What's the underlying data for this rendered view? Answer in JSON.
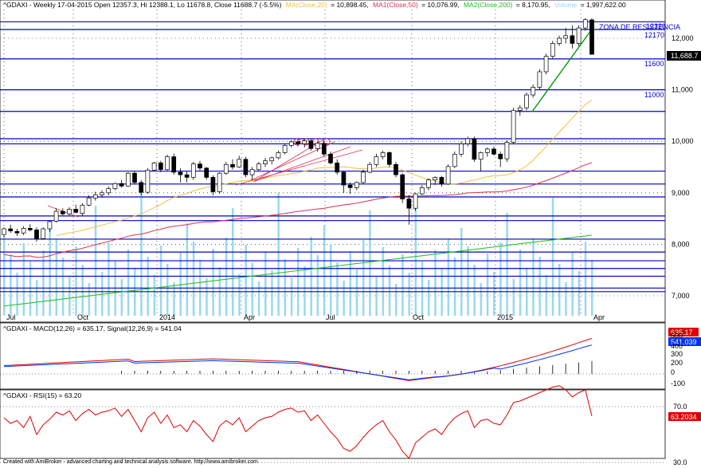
{
  "colors": {
    "up_candle": "#ffffff",
    "down_candle": "#000000",
    "ma20": "#f0c040",
    "ma50": "#e03050",
    "ma200": "#18c018",
    "volume": "#9ad8ee",
    "support_lines": "#0000cc",
    "trendline_green": "#009900",
    "macd": "#e00000",
    "signal": "#0030ff",
    "rsi": "#e00000"
  },
  "price_panel": {
    "symbol": "^GDAXI",
    "header_prefix": "^GDAXI - Weekly 17-04-2015 Open 12357.3, Hi 12388.1, Lo 11678.8, Close 11688.7 (-5.5%)",
    "ma20_label": "MA(Close,20)",
    "ma20_value": "= 10,898.45,",
    "ma50_label": "MA1(Close,50)",
    "ma50_value": "= 10,076.99,",
    "ma200_label": "MA2(Close,200)",
    "ma200_value": "= 8,170.95,",
    "volume_label": "Volume",
    "volume_value": "= 1,997,622.00",
    "last_price_tag": "11,688.7",
    "zone_label": "ZONA DE RESISTENCIA",
    "level_labels": [
      "12320",
      "12170",
      "11600",
      "11000"
    ],
    "y_ticks": [
      "12,000",
      "11,000",
      "10,000",
      "9,000",
      "8,000",
      "7,000"
    ],
    "x_ticks": [
      "Jul",
      "Oct",
      "2014",
      "Apr",
      "Jul",
      "Oct",
      "2015",
      "Apr"
    ]
  },
  "macd_panel": {
    "header": "^GDAXI - MACD(12,26) = 635.17, Signal(12,26,9) = 541.04",
    "macd_tag": "635.17",
    "signal_tag": "541.039",
    "y_ticks": [
      "500",
      "400",
      "300",
      "200",
      "0",
      "-100"
    ]
  },
  "rsi_panel": {
    "header": "^GDAXI - RSI(15) = 63.20",
    "rsi_tag": "63.2034",
    "y_ticks": [
      "70.0",
      "30.0"
    ]
  },
  "footer": "Created with AmiBroker - advanced charting and technical analysis software. http://www.amibroker.com",
  "chart_data": {
    "type": "candlestick",
    "title": "^GDAXI - Weekly",
    "ylim": [
      6700,
      12450
    ],
    "support_resistance_levels": [
      12320,
      12170,
      11600,
      11000,
      10580,
      10050,
      9950,
      9420,
      9170,
      8920,
      8550,
      8460,
      8100,
      7850,
      7680,
      7530,
      7380,
      7150,
      7080
    ],
    "ohlc": [
      [
        8190,
        8330,
        8140,
        8300
      ],
      [
        8300,
        8380,
        8220,
        8260
      ],
      [
        8250,
        8300,
        8160,
        8220
      ],
      [
        8220,
        8350,
        8180,
        8310
      ],
      [
        8310,
        8390,
        8250,
        8280
      ],
      [
        8280,
        8330,
        8050,
        8100
      ],
      [
        8110,
        8330,
        8090,
        8300
      ],
      [
        8300,
        8460,
        8240,
        8440
      ],
      [
        8450,
        8700,
        8420,
        8640
      ],
      [
        8640,
        8700,
        8560,
        8590
      ],
      [
        8590,
        8720,
        8560,
        8680
      ],
      [
        8680,
        8770,
        8600,
        8620
      ],
      [
        8600,
        8800,
        8550,
        8760
      ],
      [
        8760,
        8950,
        8740,
        8900
      ],
      [
        8900,
        9020,
        8850,
        8960
      ],
      [
        8960,
        9050,
        8900,
        9000
      ],
      [
        9000,
        9120,
        8950,
        9080
      ],
      [
        9080,
        9200,
        9050,
        9180
      ],
      [
        9180,
        9250,
        9100,
        9130
      ],
      [
        9130,
        9400,
        9120,
        9380
      ],
      [
        9380,
        9420,
        9160,
        9200
      ],
      [
        9200,
        9250,
        8950,
        9010
      ],
      [
        9010,
        9480,
        8980,
        9440
      ],
      [
        9440,
        9600,
        9420,
        9580
      ],
      [
        9580,
        9620,
        9400,
        9450
      ],
      [
        9450,
        9740,
        9420,
        9700
      ],
      [
        9700,
        9760,
        9350,
        9400
      ],
      [
        9400,
        9480,
        9200,
        9350
      ],
      [
        9350,
        9420,
        9200,
        9300
      ],
      [
        9300,
        9600,
        9250,
        9560
      ],
      [
        9560,
        9620,
        9420,
        9480
      ],
      [
        9480,
        9500,
        9250,
        9300
      ],
      [
        9300,
        9340,
        8950,
        9020
      ],
      [
        9020,
        9400,
        8980,
        9380
      ],
      [
        9380,
        9600,
        9350,
        9550
      ],
      [
        9550,
        9650,
        9450,
        9500
      ],
      [
        9500,
        9720,
        9480,
        9650
      ],
      [
        9650,
        9700,
        9300,
        9350
      ],
      [
        9350,
        9500,
        9250,
        9450
      ],
      [
        9450,
        9600,
        9420,
        9560
      ],
      [
        9560,
        9680,
        9500,
        9620
      ],
      [
        9620,
        9700,
        9550,
        9680
      ],
      [
        9680,
        9820,
        9650,
        9780
      ],
      [
        9780,
        9950,
        9750,
        9920
      ],
      [
        9920,
        10020,
        9880,
        9990
      ],
      [
        9990,
        10050,
        9900,
        9950
      ],
      [
        9950,
        10060,
        9880,
        10010
      ],
      [
        10010,
        10050,
        9820,
        9860
      ],
      [
        9860,
        10000,
        9800,
        9960
      ],
      [
        9960,
        10000,
        9700,
        9750
      ],
      [
        9750,
        9800,
        9550,
        9580
      ],
      [
        9580,
        9650,
        9350,
        9400
      ],
      [
        9400,
        9420,
        9000,
        9150
      ],
      [
        9150,
        9200,
        8980,
        9100
      ],
      [
        9100,
        9220,
        9050,
        9200
      ],
      [
        9200,
        9450,
        9180,
        9400
      ],
      [
        9400,
        9600,
        9380,
        9550
      ],
      [
        9550,
        9760,
        9500,
        9700
      ],
      [
        9700,
        9820,
        9650,
        9780
      ],
      [
        9780,
        9800,
        9500,
        9550
      ],
      [
        9550,
        9600,
        9300,
        9350
      ],
      [
        9350,
        9380,
        8800,
        8880
      ],
      [
        8880,
        8950,
        8380,
        8700
      ],
      [
        8700,
        9000,
        8650,
        8980
      ],
      [
        8980,
        9150,
        8950,
        9100
      ],
      [
        9100,
        9280,
        9050,
        9250
      ],
      [
        9250,
        9320,
        9150,
        9300
      ],
      [
        9300,
        9330,
        9120,
        9170
      ],
      [
        9170,
        9550,
        9150,
        9510
      ],
      [
        9510,
        9800,
        9480,
        9750
      ],
      [
        9750,
        10000,
        9700,
        9950
      ],
      [
        9950,
        10090,
        9900,
        10050
      ],
      [
        10050,
        10090,
        9600,
        9650
      ],
      [
        9650,
        9800,
        9420,
        9780
      ],
      [
        9780,
        9880,
        9700,
        9850
      ],
      [
        9850,
        9900,
        9720,
        9750
      ],
      [
        9750,
        9800,
        9500,
        9660
      ],
      [
        9660,
        10020,
        9600,
        9980
      ],
      [
        9980,
        10650,
        9950,
        10600
      ],
      [
        10600,
        10700,
        10500,
        10650
      ],
      [
        10650,
        10950,
        10600,
        10900
      ],
      [
        10900,
        11100,
        10850,
        11050
      ],
      [
        11050,
        11400,
        11000,
        11350
      ],
      [
        11350,
        11700,
        11300,
        11650
      ],
      [
        11650,
        11950,
        11600,
        11900
      ],
      [
        11900,
        12050,
        11850,
        12000
      ],
      [
        12000,
        12200,
        11900,
        12050
      ],
      [
        12050,
        12250,
        11800,
        11900
      ],
      [
        11900,
        12250,
        11850,
        12200
      ],
      [
        12200,
        12390,
        12150,
        12360
      ],
      [
        12357.3,
        12388.1,
        11678.8,
        11688.7
      ]
    ],
    "macd": {
      "last_value": 635.17,
      "signal_last_value": 541.04
    },
    "rsi": {
      "period": 15,
      "last_value": 63.2
    }
  }
}
